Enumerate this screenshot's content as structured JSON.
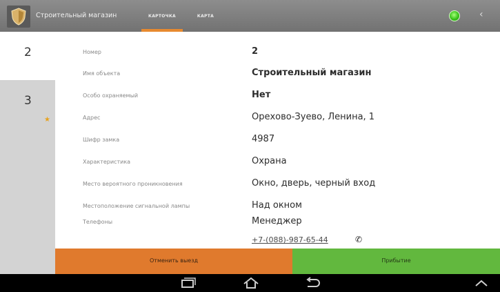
{
  "header": {
    "title": "Строительный магазин",
    "tabs": [
      {
        "label": "КАРТОЧКА",
        "active": true
      },
      {
        "label": "КАРТА",
        "active": false
      }
    ],
    "status_color": "#39c21a"
  },
  "sidebar": {
    "items": [
      {
        "number": "2",
        "active": true
      },
      {
        "number": "3",
        "active": false,
        "starred": true
      }
    ]
  },
  "details": {
    "rows": [
      {
        "label": "Номер",
        "value": "2"
      },
      {
        "label": "Имя объекта",
        "value": "Строительный магазин"
      },
      {
        "label": "Особо охраняемый",
        "value": "Нет"
      },
      {
        "label": "Адрес",
        "value": "Орехово-Зуево, Ленина, 1"
      },
      {
        "label": "Шифр замка",
        "value": "4987"
      },
      {
        "label": "Характеристика",
        "value": "Охрана"
      },
      {
        "label": "Место вероятного проникновения",
        "value": "Окно, дверь, черный вход"
      },
      {
        "label": "Местоположение сигнальной лампы",
        "value": "Над окном"
      },
      {
        "label": "Телефоны",
        "value": "Менеджер",
        "phone": "+7-(088)-987-65-44"
      }
    ]
  },
  "actions": {
    "cancel_label": "Отменить выезд",
    "arrive_label": "Прибытие",
    "cancel_color": "#e07a2d",
    "arrive_color": "#62b83e"
  },
  "navbar": {
    "icons": [
      "recents-icon",
      "home-icon",
      "back-icon",
      "chevron-up-icon"
    ]
  }
}
